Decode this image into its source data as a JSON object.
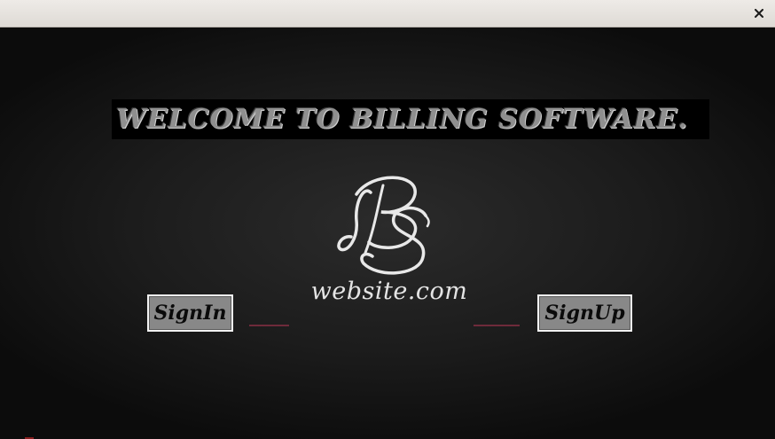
{
  "window": {
    "close_icon": "close-icon"
  },
  "header": {
    "welcome_text": "WELCOME TO BILLING SOFTWARE."
  },
  "logo": {
    "monogram": "BS",
    "caption": "website.com"
  },
  "buttons": {
    "signin_label": "SignIn",
    "signup_label": "SignUp"
  },
  "colors": {
    "background": "#1c1c1c",
    "banner_bg": "#000000",
    "welcome_text": "#8f8f8f",
    "button_bg": "#888888",
    "button_border": "#f2f2f2",
    "accent_line": "#6e2a3a"
  }
}
